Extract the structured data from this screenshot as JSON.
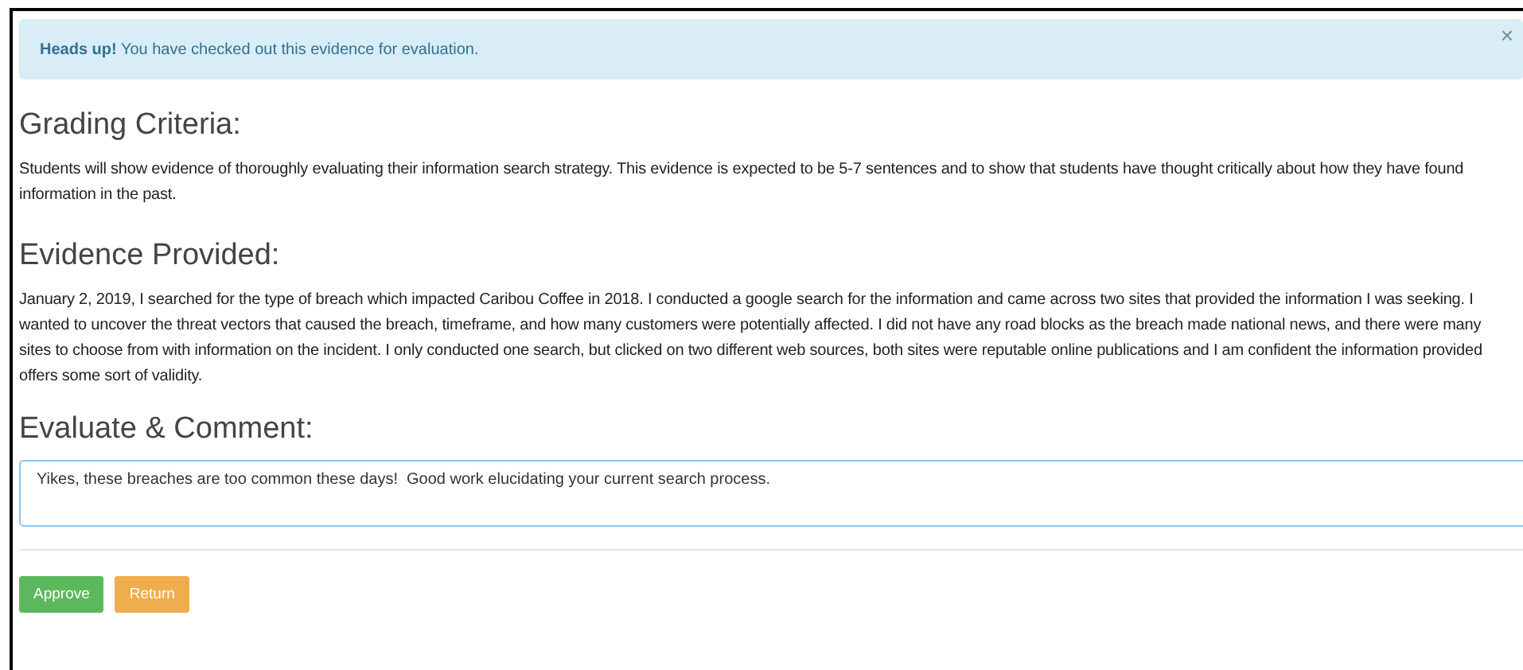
{
  "alert": {
    "message": "**Heads up!** You have checked out this evidence for evaluation.",
    "close": "×"
  },
  "sections": [
    {
      "heading": "Grading Criteria:",
      "text": "Students will show evidence of thoroughly evaluating their information search strategy. This evidence is expected to be 5-7 sentences and to show that students have thought critically about how they have found information in the past."
    },
    {
      "heading": "Evidence Provided:",
      "text": "January 2, 2019, I searched for the type of breach which impacted Caribou Coffee in 2018.  I conducted a google search for the information and came across two sites that provided the information I was seeking. I wanted to uncover the threat vectors that caused the breach, timeframe, and how many customers were potentially affected.  I did not have any road blocks as the breach made national news, and there were many sites to choose from with information on the incident.  I only conducted one search, but clicked on two different web sources, both sites were reputable online publications and I am confident the information provided offers some sort of validity."
    }
  ],
  "comment": {
    "heading": "Evaluate & Comment:",
    "value": "Yikes, these breaches are too common these days!  Good work elucidating your current search process."
  },
  "buttons": [
    {
      "label": "Approve",
      "kind": "success"
    },
    {
      "label": "Return",
      "kind": "warning"
    }
  ]
}
